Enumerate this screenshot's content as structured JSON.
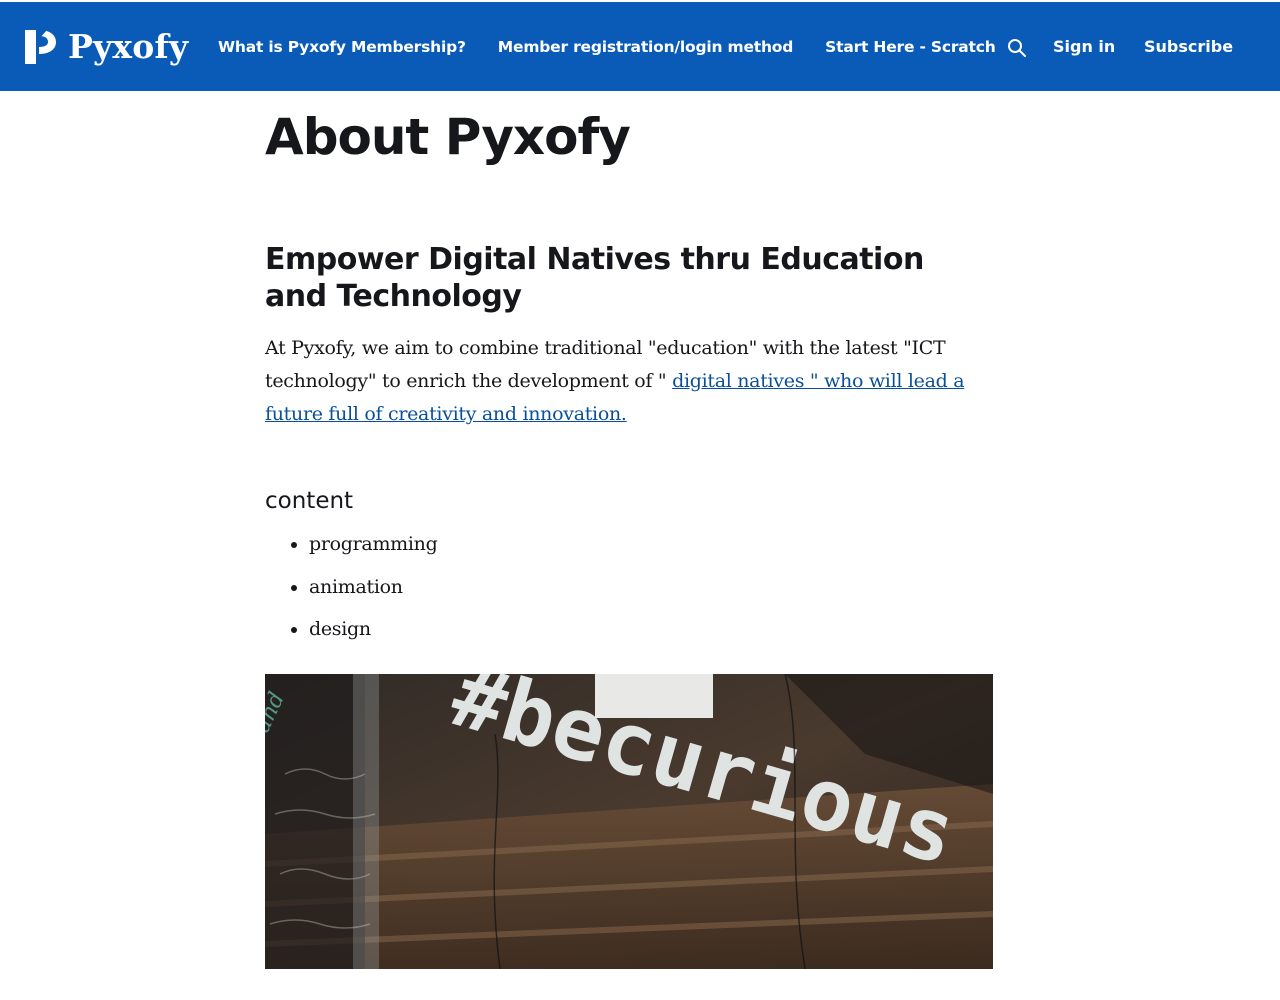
{
  "brand": {
    "name": "Pyxofy",
    "logo_icon": "pyxofy-logo-icon",
    "nav_bg": "#0a5bb8"
  },
  "nav": {
    "items": [
      {
        "label": "What is Pyxofy Membership?"
      },
      {
        "label": "Member registration/login method"
      },
      {
        "label": "Start Here - Scratch"
      }
    ],
    "search_icon": "search-icon",
    "signin_label": "Sign in",
    "subscribe_label": "Subscribe"
  },
  "page": {
    "title": "About Pyxofy",
    "section_heading": "Empower Digital Natives thru Education and Technology",
    "intro_text": "At Pyxofy, we aim to combine traditional \"education\" with the latest \"ICT technology\" to enrich the development of \" ",
    "intro_link": "digital natives \" who will lead a future full of creativity and innovation.",
    "content_heading": "content",
    "content_items": [
      "programming",
      "animation",
      "design"
    ],
    "link_color": "#0a4f99"
  },
  "hero": {
    "sign_text": "#becurious"
  }
}
